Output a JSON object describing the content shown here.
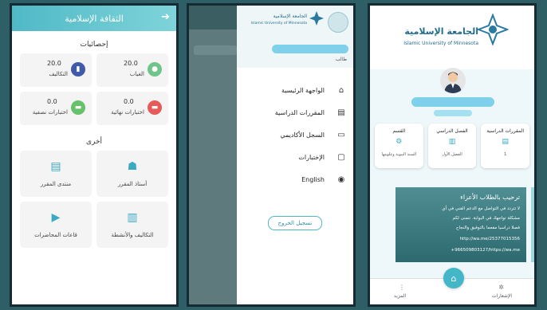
{
  "screen1": {
    "title": "الثقافة الإسلامية",
    "back_icon": "arrow-right-icon",
    "stats_heading": "إحصائيات",
    "stats": [
      {
        "value": "20.0",
        "label": "الغياب",
        "color": "#6fc48b",
        "icon": "user-icon"
      },
      {
        "value": "20.0",
        "label": "التكاليف",
        "color": "#3e5aa8",
        "icon": "chart-icon"
      },
      {
        "value": "0.0",
        "label": "اختبارات نهائية",
        "color": "#e65a5a",
        "icon": "chat-icon"
      },
      {
        "value": "0.0",
        "label": "اختبارات نصفية",
        "color": "#67c06a",
        "icon": "chat-icon"
      }
    ],
    "other_heading": "أخرى",
    "others": [
      {
        "label": "أستاذ المقرر",
        "icon": "teacher-icon"
      },
      {
        "label": "منتدى المقرر",
        "icon": "forum-icon"
      },
      {
        "label": "التكاليف والأنشطة",
        "icon": "activities-icon"
      },
      {
        "label": "قاعات المحاضرات",
        "icon": "video-icon"
      }
    ]
  },
  "screen2": {
    "logo_ar": "الجامعة الإسلامية",
    "logo_en": "Islamic University of Minnesota",
    "role": "طالب",
    "menu": [
      {
        "label": "الواجهة الرئيسية",
        "icon": "home-icon",
        "glyph": "⌂"
      },
      {
        "label": "المقررات الدراسية",
        "icon": "book-icon",
        "glyph": "▤"
      },
      {
        "label": "السجل الأكاديمي",
        "icon": "record-icon",
        "glyph": "▭"
      },
      {
        "label": "الإختبارات",
        "icon": "exam-icon",
        "glyph": "▢"
      },
      {
        "label": "English",
        "icon": "globe-icon",
        "glyph": "◉"
      }
    ],
    "logout": "تسجيل الخروج"
  },
  "screen3": {
    "uni_ar": "الجامعة الإسلامية",
    "uni_en": "Islamic University of Minnesota",
    "cards": [
      {
        "title": "المقررات الدراسية",
        "value": "1",
        "icon": "courses-icon",
        "glyph": "▤"
      },
      {
        "title": "الفصل الدراسي",
        "value": "الفصل الأول",
        "icon": "semester-icon",
        "glyph": "▥"
      },
      {
        "title": "القسم",
        "value": "السنة النبوية وعلومها",
        "icon": "department-icon",
        "glyph": "⚙"
      }
    ],
    "banner": {
      "title": "ترحيب بالطلاب الأعزاء",
      "lines": [
        "لا تتردد في التواصل مع الدعم الفني في أي",
        "مشكلة تواجهك في البوابة. نتمنى لكم",
        "فصلا دراسيا مفعما بالتوفيق والنجاح",
        "http://wa.me/25377015356",
        "+966509803127/https://wa.me"
      ]
    },
    "nav": {
      "left_label": "المزيد",
      "right_label": "الإشعارات"
    }
  }
}
